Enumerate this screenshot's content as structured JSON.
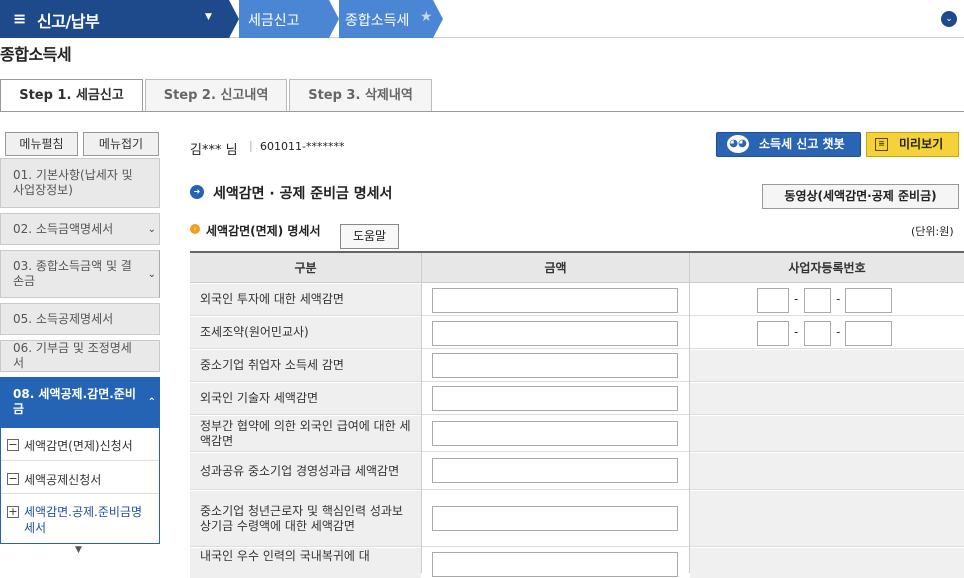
{
  "topbar": {
    "menu_icon": "≡",
    "menu_title": "신고/납부",
    "breadcrumb": [
      "세금신고",
      "종합소득세"
    ]
  },
  "page_title": "종합소득세",
  "tabs": [
    "Step 1. 세금신고",
    "Step 2. 신고내역",
    "Step 3. 삭제내역"
  ],
  "sidebar": {
    "expand_label": "메뉴펼침",
    "collapse_label": "메뉴접기",
    "items": [
      "01. 기본사항(납세자 및 사업장정보)",
      "02. 소득금액명세서",
      "03. 종합소득금액 및 결손금",
      "05. 소득공제명세서",
      "06. 기부금 및 조정명세서",
      "08. 세액공제.감면.준비금"
    ],
    "sub_items": [
      "세액감면(면제)신청서",
      "세액공제신청서",
      "세액감면.공제.준비금명세서"
    ]
  },
  "user": {
    "name": "김*** 님",
    "id": "601011-*******"
  },
  "buttons": {
    "chatbot": "소득세 신고 챗봇",
    "preview": "미리보기",
    "video": "동영상(세액감면·공제 준비금)",
    "help": "도움말"
  },
  "section_title": "세액감면 · 공제 준비금 명세서",
  "subsection_title": "세액감면(면제) 명세서",
  "unit_label": "(단위:원)",
  "table": {
    "headers": [
      "구분",
      "금액",
      "사업자등록번호"
    ],
    "rows": [
      "외국인 투자에 대한 세액감면",
      "조세조약(원어민교사)",
      "중소기업 취업자 소득세 감면",
      "외국인 기술자 세액감면",
      "정부간 협약에 의한 외국인 급여에 대한 세액감면",
      "성과공유 중소기업 경영성과급 세액감면",
      "중소기업 청년근로자 및 핵심인력 성과보상기금 수령액에 대한 세액감면",
      "내국인 우수 인력의 국내복귀에 대"
    ]
  },
  "colors": {
    "primary": "#1e4a8c",
    "accent": "#2563b5",
    "preview": "#f5d23a"
  }
}
